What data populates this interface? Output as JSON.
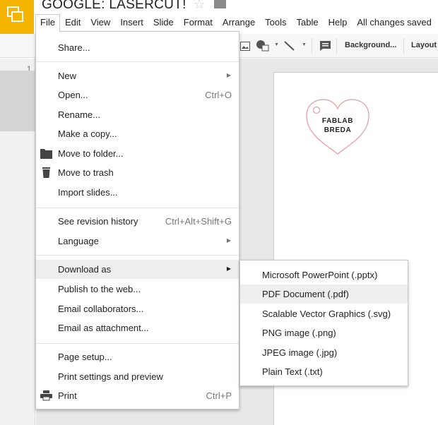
{
  "app": {
    "title": "GOOGLE: LASERCUT!",
    "save_status": "All changes saved"
  },
  "menubar": {
    "items": [
      "File",
      "Edit",
      "View",
      "Insert",
      "Slide",
      "Format",
      "Arrange",
      "Tools",
      "Table",
      "Help"
    ],
    "active": "File"
  },
  "toolbar": {
    "background_label": "Background...",
    "layout_label": "Layout"
  },
  "filmstrip": {
    "slide_number": "1"
  },
  "slide": {
    "heart_text_line1": "FABLAB",
    "heart_text_line2": "BREDA",
    "heart_color": "#e0a0a6"
  },
  "file_menu": {
    "items": [
      {
        "label": "Share..."
      },
      {
        "label": "New",
        "submenu": true
      },
      {
        "label": "Open...",
        "shortcut": "Ctrl+O"
      },
      {
        "label": "Rename..."
      },
      {
        "label": "Make a copy..."
      },
      {
        "label": "Move to folder...",
        "icon": "folder-icon"
      },
      {
        "label": "Move to trash",
        "icon": "trash-icon"
      },
      {
        "label": "Import slides..."
      },
      {
        "label": "See revision history",
        "shortcut": "Ctrl+Alt+Shift+G"
      },
      {
        "label": "Language",
        "submenu": true
      },
      {
        "label": "Download as",
        "submenu": true,
        "highlighted": true
      },
      {
        "label": "Publish to the web..."
      },
      {
        "label": "Email collaborators..."
      },
      {
        "label": "Email as attachment..."
      },
      {
        "label": "Page setup..."
      },
      {
        "label": "Print settings and preview"
      },
      {
        "label": "Print",
        "shortcut": "Ctrl+P",
        "icon": "printer-icon"
      }
    ]
  },
  "download_submenu": {
    "items": [
      {
        "label": "Microsoft PowerPoint (.pptx)"
      },
      {
        "label": "PDF Document (.pdf)",
        "highlighted": true
      },
      {
        "label": "Scalable Vector Graphics (.svg)"
      },
      {
        "label": "PNG image (.png)"
      },
      {
        "label": "JPEG image (.jpg)"
      },
      {
        "label": "Plain Text (.txt)"
      }
    ]
  },
  "colors": {
    "brand_yellow": "#f4b400",
    "menu_hover": "#eeeeee"
  }
}
